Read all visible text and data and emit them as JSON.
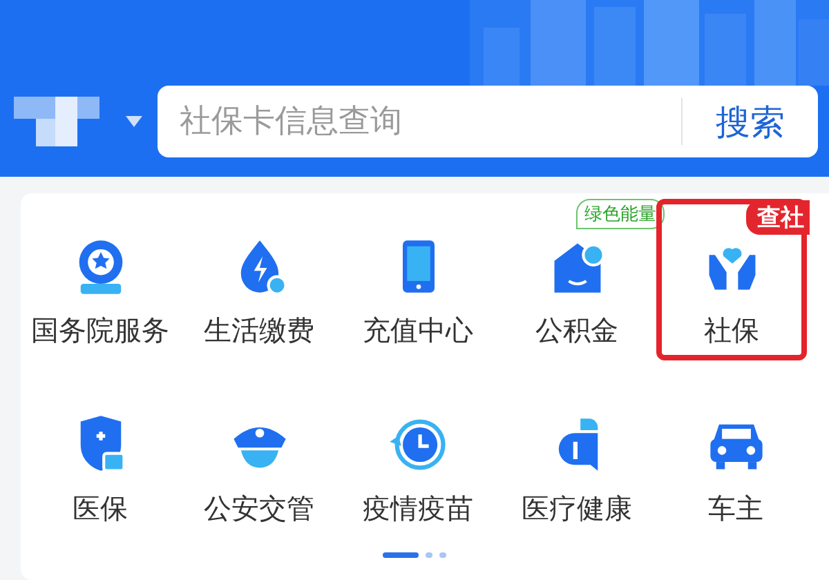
{
  "header": {
    "search": {
      "placeholder": "社保卡信息查询",
      "button": "搜索"
    }
  },
  "services": [
    {
      "label": "国务院服务",
      "highlighted": false
    },
    {
      "label": "生活缴费",
      "highlighted": false
    },
    {
      "label": "充值中心",
      "highlighted": false
    },
    {
      "label": "公积金",
      "highlighted": false,
      "badge": {
        "text": "绿色能量",
        "kind": "outline"
      }
    },
    {
      "label": "社保",
      "highlighted": true,
      "badge": {
        "text": "查社",
        "kind": "solid"
      }
    },
    {
      "label": "医保",
      "highlighted": false
    },
    {
      "label": "公安交管",
      "highlighted": false
    },
    {
      "label": "疫情疫苗",
      "highlighted": false
    },
    {
      "label": "医疗健康",
      "highlighted": false
    },
    {
      "label": "车主",
      "highlighted": false
    }
  ],
  "pager": [
    {
      "selected": true
    },
    {
      "selected": false
    },
    {
      "selected": false
    }
  ]
}
